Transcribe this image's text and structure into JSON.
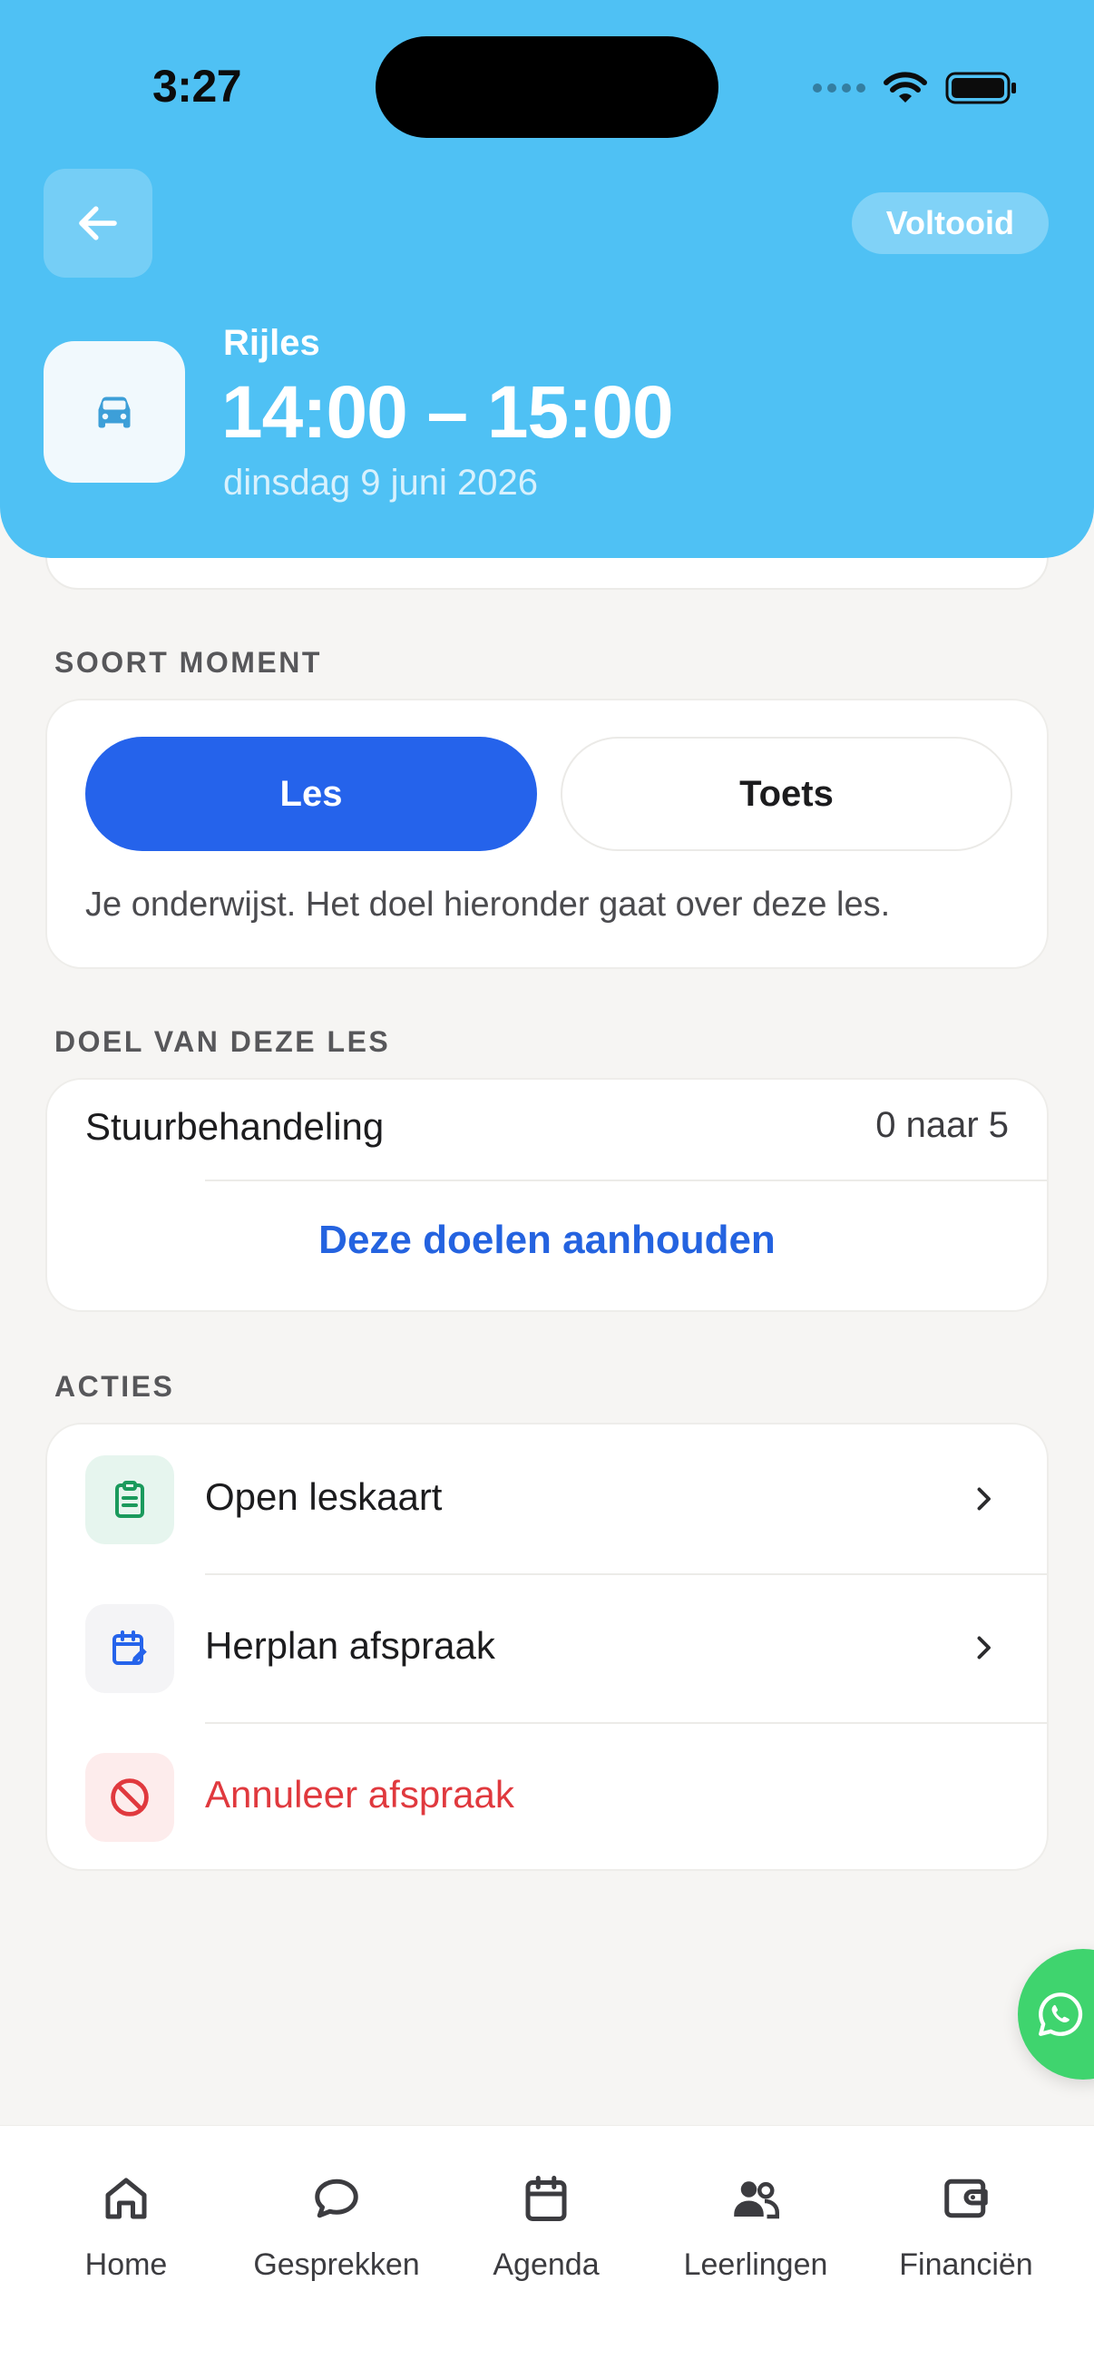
{
  "status_bar": {
    "time": "3:27"
  },
  "header": {
    "status_badge": "Voltooid",
    "lesson_type": "Rijles",
    "time_range": "14:00 – 15:00",
    "date": "dinsdag 9 juni 2026",
    "accent_color": "#4fc1f4"
  },
  "moment": {
    "section_title": "SOORT MOMENT",
    "options": [
      "Les",
      "Toets"
    ],
    "selected": "Les",
    "description": "Je onderwijst. Het doel hieronder gaat over deze les."
  },
  "goal": {
    "section_title": "DOEL VAN DEZE LES",
    "name": "Stuurbehandeling",
    "progress": "0 naar 5",
    "keep_label": "Deze doelen aanhouden"
  },
  "actions": {
    "section_title": "ACTIES",
    "items": [
      {
        "label": "Open leskaart",
        "icon": "clipboard-icon"
      },
      {
        "label": "Herplan afspraak",
        "icon": "calendar-edit-icon"
      },
      {
        "label": "Annuleer afspraak",
        "icon": "cancel-icon",
        "color": "#e0393e"
      }
    ]
  },
  "tabbar": {
    "items": [
      {
        "label": "Home",
        "icon": "home-icon"
      },
      {
        "label": "Gesprekken",
        "icon": "chat-icon"
      },
      {
        "label": "Agenda",
        "icon": "calendar-icon"
      },
      {
        "label": "Leerlingen",
        "icon": "people-icon"
      },
      {
        "label": "Financiën",
        "icon": "wallet-icon"
      }
    ]
  }
}
